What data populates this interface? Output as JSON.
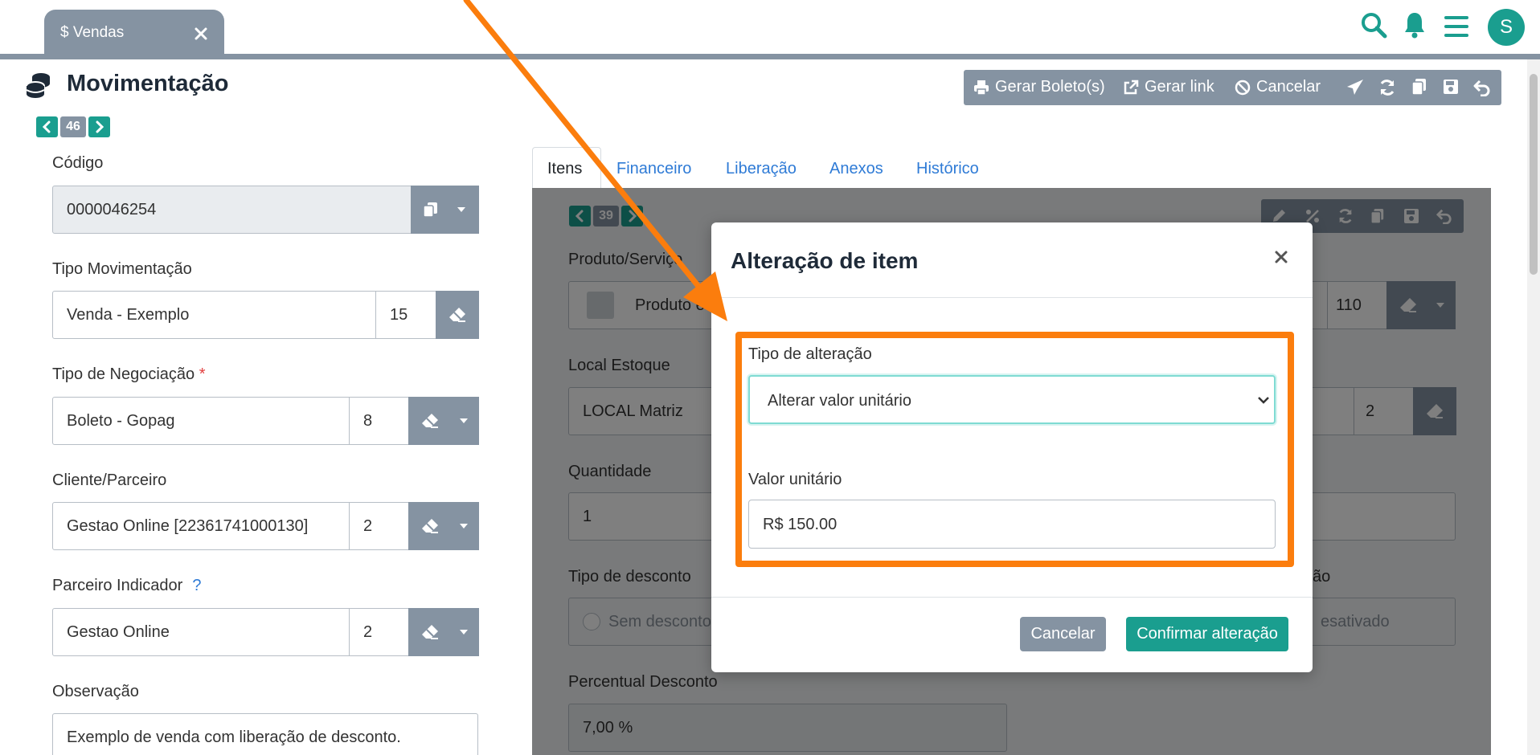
{
  "tab": {
    "icon": "dollar-icon",
    "symbol": "$",
    "label": "Vendas"
  },
  "user": {
    "initial": "S"
  },
  "page": {
    "title": "Movimentação",
    "record_count": "46"
  },
  "toolbar": {
    "boleto_label": "Gerar Boleto(s)",
    "link_label": "Gerar link",
    "cancel_label": "Cancelar"
  },
  "form": {
    "codigo": {
      "label": "Código",
      "value": "0000046254"
    },
    "tipo_movimentacao": {
      "label": "Tipo Movimentação",
      "value": "Venda - Exemplo",
      "code": "15"
    },
    "tipo_negociacao": {
      "label": "Tipo de Negociação",
      "required_mark": "*",
      "value": "Boleto - Gopag",
      "code": "8"
    },
    "cliente": {
      "label": "Cliente/Parceiro",
      "value": "Gestao Online [22361741000130]",
      "code": "2"
    },
    "parceiro_indicador": {
      "label": "Parceiro Indicador",
      "help": "?",
      "value": "Gestao Online",
      "code": "2"
    },
    "observacao": {
      "label": "Observação",
      "value": "Exemplo de venda com liberação de desconto."
    }
  },
  "item_tabs": [
    "Itens",
    "Financeiro",
    "Liberação",
    "Anexos",
    "Histórico"
  ],
  "item": {
    "count": "39",
    "produto": {
      "label": "Produto/Serviço",
      "value": "Produto e",
      "code": "110"
    },
    "local_estoque": {
      "label": "Local Estoque",
      "value": "LOCAL Matriz",
      "code": "2"
    },
    "quantidade": {
      "label": "Quantidade",
      "value": "1"
    },
    "tipo_desconto": {
      "label": "Tipo de desconto",
      "value": "Sem desconto"
    },
    "desconto_right": {
      "label": "ão",
      "value": "esativado"
    },
    "percentual": {
      "label": "Percentual Desconto",
      "value": "7,00 %"
    }
  },
  "modal": {
    "title": "Alteração de item",
    "tipo_label": "Tipo de alteração",
    "tipo_value": "Alterar valor unitário",
    "valor_label": "Valor unitário",
    "valor_value": "R$ 150.00",
    "cancel_label": "Cancelar",
    "confirm_label": "Confirmar alteração"
  },
  "colors": {
    "teal": "#1a9e8f",
    "gray": "#8593a2",
    "annotation": "#fb7d0d",
    "link": "#2f7bd6"
  }
}
